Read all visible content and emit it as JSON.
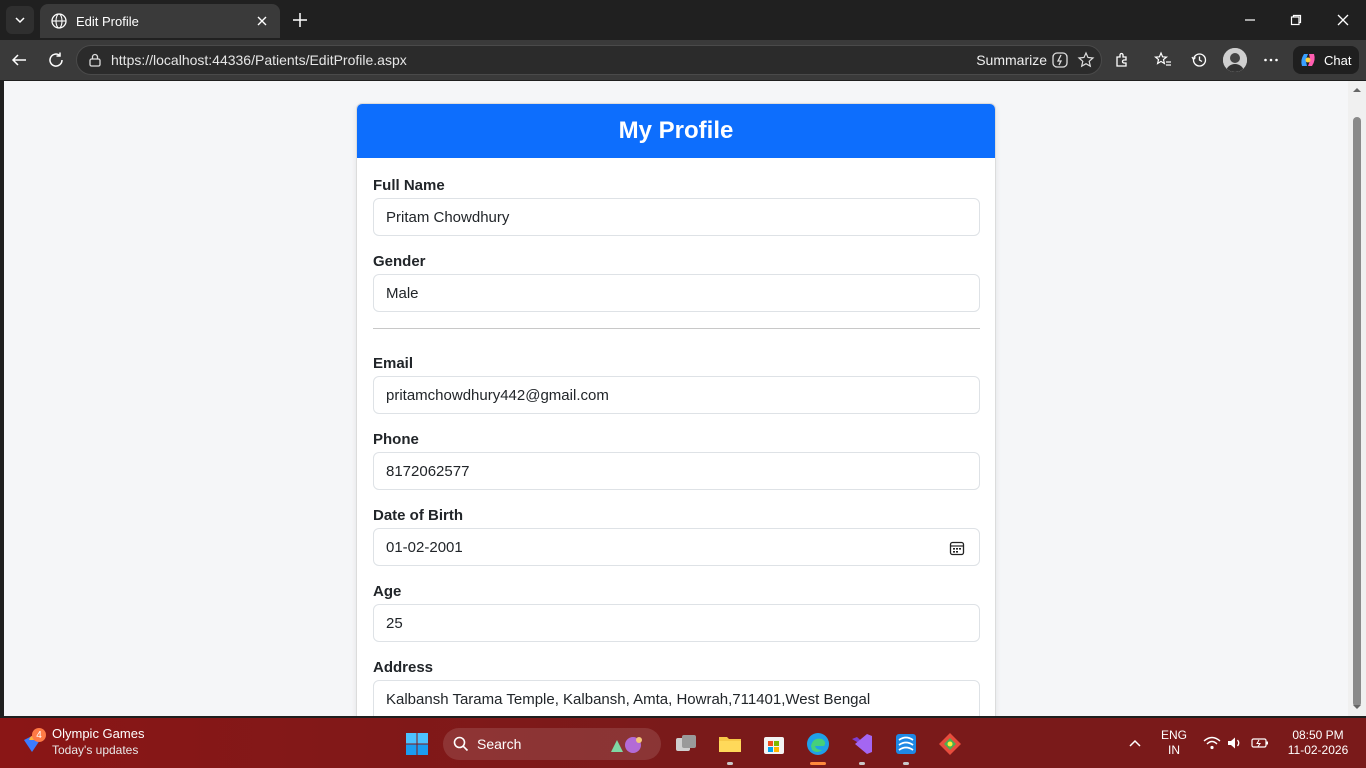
{
  "browser": {
    "tab_title": "Edit Profile",
    "url": "https://localhost:44336/Patients/EditProfile.aspx",
    "summarize_label": "Summarize",
    "chat_label": "Chat"
  },
  "page": {
    "title": "My Profile",
    "fields": {
      "full_name_label": "Full Name",
      "full_name_value": "Pritam Chowdhury",
      "gender_label": "Gender",
      "gender_value": "Male",
      "email_label": "Email",
      "email_value": "pritamchowdhury442@gmail.com",
      "phone_label": "Phone",
      "phone_value": "8172062577",
      "dob_label": "Date of Birth",
      "dob_value": "01-02-2001",
      "age_label": "Age",
      "age_value": "25",
      "address_label": "Address",
      "address_value": "Kalbansh Tarama Temple, Kalbansh, Amta, Howrah,711401,West Bengal"
    },
    "accent_color": "#0d6efd"
  },
  "taskbar": {
    "widget_badge": "4",
    "widget_title": "Olympic Games",
    "widget_subtitle": "Today's updates",
    "search_label": "Search",
    "lang_line1": "ENG",
    "lang_line2": "IN",
    "time": "08:50 PM",
    "date": "11-02-2026"
  }
}
